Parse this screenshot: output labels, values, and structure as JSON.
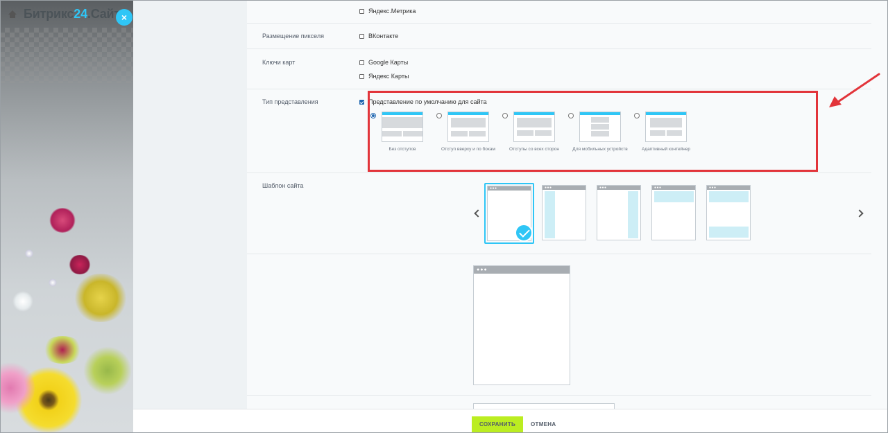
{
  "brand": {
    "name_part1": "Битрикс",
    "name_part2": "24",
    "name_part3": ".Сайты",
    "close_symbol": "×"
  },
  "rows": {
    "metrica_option": "Яндекс.Метрика",
    "pixel_label": "Размещение пикселя",
    "pixel_option": "ВКонтакте",
    "maps_label": "Ключи карт",
    "maps_option_google": "Google Карты",
    "maps_option_yandex": "Яндекс Карты",
    "view_type_label": "Тип представления",
    "view_type_default": "Представление по умолчанию для сайта",
    "template_label": "Шаблон сайта"
  },
  "layouts": [
    {
      "caption": "Без отступов",
      "selected": true
    },
    {
      "caption": "Отступ вверху и по бокам",
      "selected": false
    },
    {
      "caption": "Отступы со всех сторон",
      "selected": false
    },
    {
      "caption": "Для мобильных устройств",
      "selected": false
    },
    {
      "caption": "Адаптивный контейнер",
      "selected": false
    }
  ],
  "templates": {
    "count": 5,
    "selected_index": 0,
    "dots": "●●●"
  },
  "footer": {
    "save_label": "СОХРАНИТЬ",
    "cancel_label": "ОТМЕНА"
  },
  "colors": {
    "accent": "#2fc6f6",
    "save_button": "#bbed21",
    "highlight": "#e2343a"
  }
}
